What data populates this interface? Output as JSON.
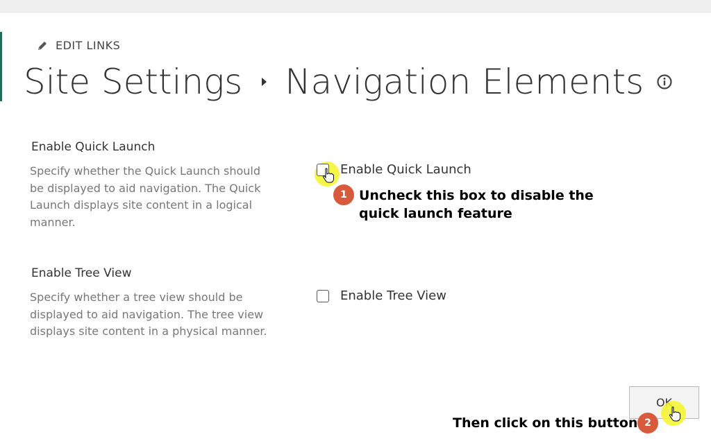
{
  "header": {
    "edit_links_label": "EDIT LINKS",
    "breadcrumb_parent": "Site Settings",
    "page_title": "Navigation Elements"
  },
  "sections": [
    {
      "heading": "Enable Quick Launch",
      "description": "Specify whether the Quick Launch should be displayed to aid navigation.  The Quick Launch displays site content in a logical manner.",
      "checkbox_label": "Enable Quick Launch",
      "checked": false
    },
    {
      "heading": "Enable Tree View",
      "description": "Specify whether a tree view should be displayed to aid navigation.  The tree view displays site content in a physical manner.",
      "checkbox_label": "Enable Tree View",
      "checked": false
    }
  ],
  "footer": {
    "ok_label": "OK"
  },
  "annotations": {
    "step1_number": "1",
    "step1_line1": "Uncheck this box to disable the",
    "step1_line2": "quick launch feature",
    "step2_number": "2",
    "step2_text": "Then click on this button"
  },
  "icons": {
    "edit": "pencil-icon",
    "info": "info-icon",
    "separator": "triangle-right-icon",
    "pointer": "hand-pointer-icon"
  },
  "colors": {
    "accent": "#1f6e5c",
    "badge": "#d65a3b",
    "highlight": "#f4f42a"
  }
}
